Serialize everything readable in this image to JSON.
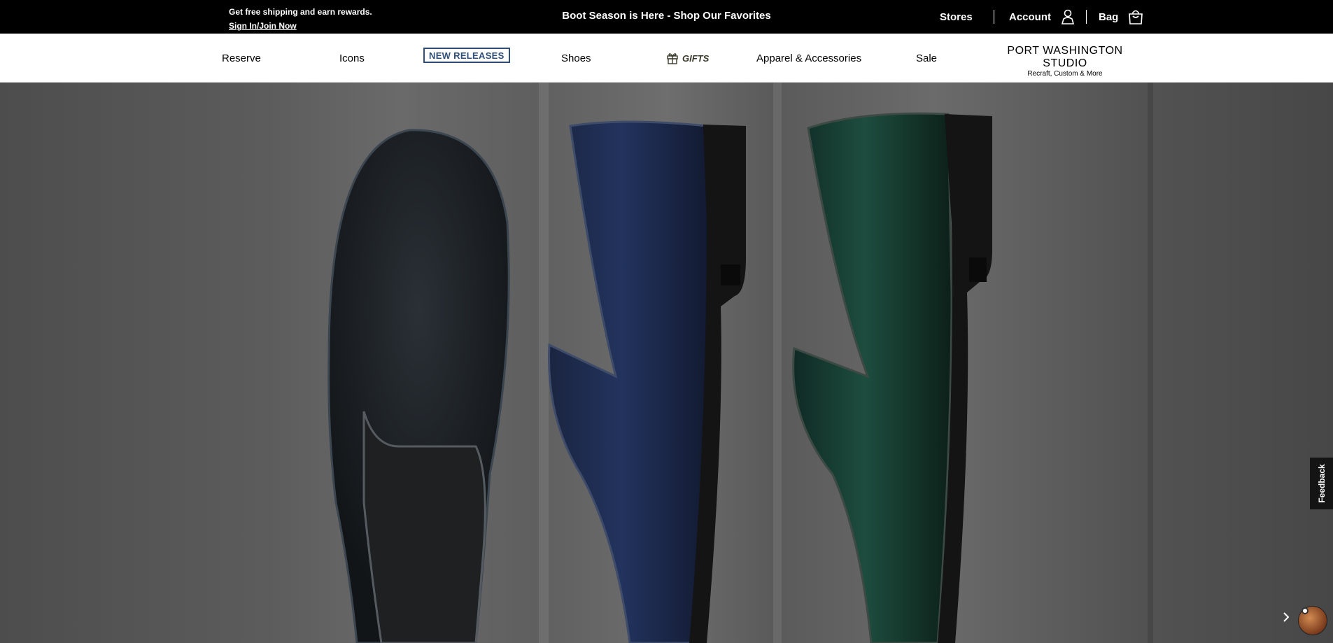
{
  "promo": {
    "shipping_text": "Get free shipping and earn rewards.",
    "signin_link": "Sign In/Join Now"
  },
  "announcement": "Boot Season is Here - Shop Our Favorites",
  "utility": {
    "stores": "Stores",
    "account": "Account",
    "bag": "Bag"
  },
  "nav": {
    "reserve": "Reserve",
    "icons": "Icons",
    "new_releases": "NEW RELEASES",
    "shoes": "Shoes",
    "gifts": "GIFTS",
    "apparel": "Apparel & Accessories",
    "sale": "Sale"
  },
  "studio": {
    "title": "PORT WASHINGTON STUDIO",
    "subtitle": "Recraft, Custom & More"
  },
  "feedback": "Feedback",
  "icons": {
    "account": "user-icon",
    "bag": "shopping-bag-icon",
    "gifts": "gift-icon",
    "next": "chevron-right-icon",
    "chat": "chat-avatar-icon"
  },
  "colors": {
    "topbar": "#000000",
    "new_releases_border": "#2f4f78",
    "feedback_bg": "#141414"
  }
}
